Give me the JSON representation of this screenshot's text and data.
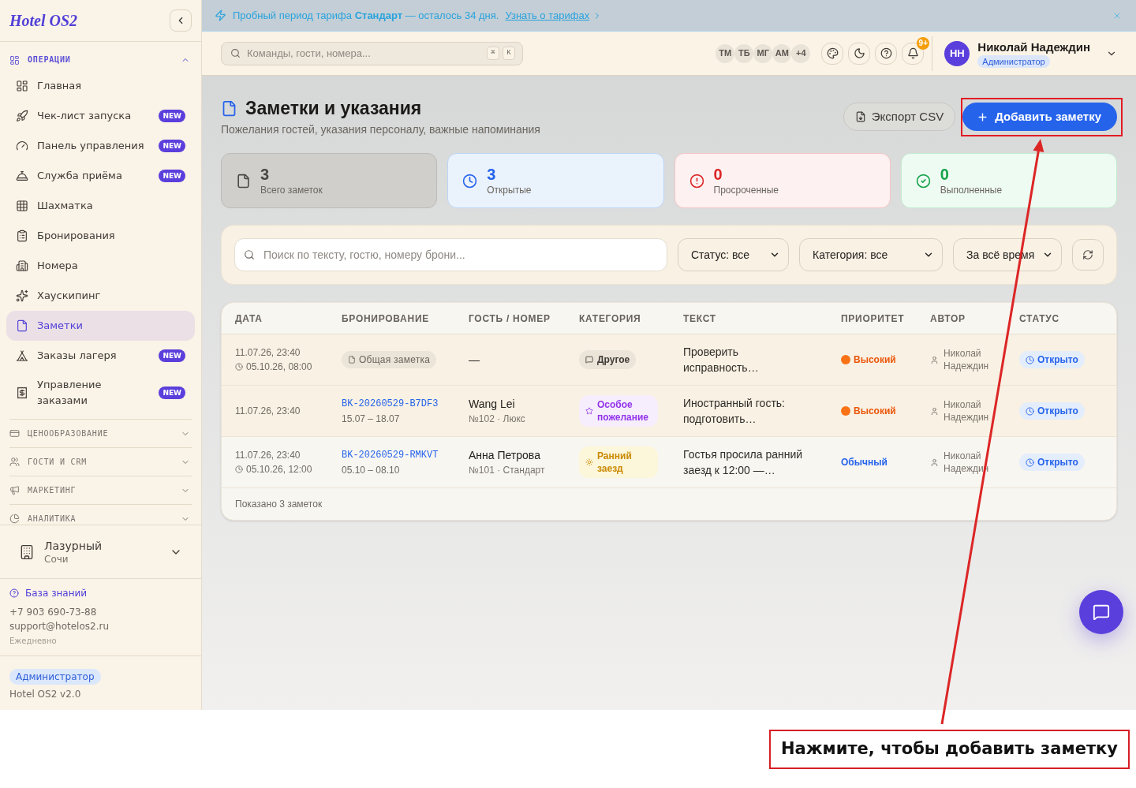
{
  "sidebar": {
    "logo": "Hotel OS2",
    "sections": [
      {
        "title": "ОПЕРАЦИИ",
        "expanded": true,
        "items": [
          {
            "label": "Главная",
            "selected": false
          },
          {
            "label": "Чек-лист запуска",
            "badge": "NEW",
            "selected": false
          },
          {
            "label": "Панель управления",
            "badge": "NEW",
            "selected": false
          },
          {
            "label": "Служба приёма",
            "badge": "NEW",
            "selected": false
          },
          {
            "label": "Шахматка",
            "selected": false
          },
          {
            "label": "Бронирования",
            "selected": false
          },
          {
            "label": "Номера",
            "selected": false
          },
          {
            "label": "Хаускипинг",
            "selected": false
          },
          {
            "label": "Заметки",
            "selected": true
          },
          {
            "label": "Заказы лагеря",
            "badge": "NEW",
            "selected": false
          },
          {
            "label": "Управление заказами",
            "badge": "NEW",
            "selected": false
          }
        ]
      },
      {
        "title": "ЦЕНООБРАЗОВАНИЕ",
        "expanded": false
      },
      {
        "title": "ГОСТИ И CRM",
        "expanded": false
      },
      {
        "title": "МАРКЕТИНГ",
        "expanded": false
      },
      {
        "title": "АНАЛИТИКА",
        "expanded": false
      }
    ],
    "property": {
      "name": "Лазурный",
      "city": "Сочи"
    },
    "support": {
      "link": "База знаний",
      "phone": "+7 903 690-73-88",
      "email": "support@hotelos2.ru",
      "hours": "Ежедневно"
    },
    "footer": {
      "role": "Администратор",
      "version": "Hotel OS2 v2.0"
    }
  },
  "banner": {
    "text": "Пробный период тарифа **Стандарт** — осталось 34 дня.",
    "link": "Узнать о тарифах"
  },
  "topbar": {
    "search": {
      "placeholder": "Команды, гости, номера...",
      "shortcut": [
        "⌘",
        "K"
      ]
    },
    "team": [
      "ТМ",
      "ТБ",
      "МГ",
      "АМ"
    ],
    "team_more": "+4",
    "notifications": "9+",
    "user": {
      "initials": "НН",
      "name": "Николай Надеждин",
      "role": "Администратор"
    }
  },
  "page": {
    "title": "Заметки и указания",
    "subtitle": "Пожелания гостей, указания персоналу, важные напоминания",
    "buttons": [
      {
        "kind": "export",
        "label": "Экспорт CSV"
      },
      {
        "kind": "add",
        "label": "Добавить заметку"
      }
    ]
  },
  "stats": [
    {
      "kind": "total",
      "value": "3",
      "label": "Всего заметок"
    },
    {
      "kind": "open",
      "value": "3",
      "label": "Открытые"
    },
    {
      "kind": "overdue",
      "value": "0",
      "label": "Просроченные"
    },
    {
      "kind": "done",
      "value": "0",
      "label": "Выполненные"
    }
  ],
  "filters": {
    "search": {
      "placeholder": "Поиск по тексту, гостю, номеру брони..."
    },
    "selects": [
      "Статус: все",
      "Категория: все",
      "За всё время"
    ]
  },
  "table": {
    "columns": [
      "ДАТА",
      "БРОНИРОВАНИЕ",
      "ГОСТЬ / НОМЕР",
      "КАТЕГОРИЯ",
      "ТЕКСТ",
      "ПРИОРИТЕТ",
      "АВТОР",
      "СТАТУС"
    ],
    "rows": [
      {
        "date": "11.07.26, 23:40",
        "due": "05.10.26, 08:00",
        "booking": {
          "kind": "general",
          "label": "Общая заметка"
        },
        "guest": {
          "name": "—"
        },
        "category": {
          "kind": "other",
          "label": "Другое"
        },
        "text": "Проверить исправность…",
        "priority": {
          "kind": "high",
          "label": "Высокий"
        },
        "author": "Николай Надеждин",
        "status": {
          "kind": "open",
          "label": "Открыто"
        }
      },
      {
        "date": "11.07.26, 23:40",
        "booking": {
          "kind": "reservation",
          "code": "BK-20260529-B7DF3",
          "dates": "15.07 – 18.07"
        },
        "guest": {
          "name": "Wang Lei",
          "room": "№102 · Люкс"
        },
        "category": {
          "kind": "special",
          "label": "Особое пожелание"
        },
        "text": "Иностранный гость: подготовить…",
        "priority": {
          "kind": "high",
          "label": "Высокий"
        },
        "author": "Николай Надеждин",
        "status": {
          "kind": "open",
          "label": "Открыто"
        }
      },
      {
        "date": "11.07.26, 23:40",
        "due": "05.10.26, 12:00",
        "booking": {
          "kind": "reservation",
          "code": "BK-20260529-RMKVT",
          "dates": "05.10 – 08.10"
        },
        "guest": {
          "name": "Анна Петрова",
          "room": "№101 · Стандарт"
        },
        "category": {
          "kind": "early",
          "label": "Ранний заезд"
        },
        "text": "Гостья просила ранний заезд к 12:00 —…",
        "priority": {
          "kind": "normal",
          "label": "Обычный"
        },
        "author": "Николай Надеждин",
        "status": {
          "kind": "open",
          "label": "Открыто"
        }
      }
    ],
    "footer": "Показано 3 заметок"
  },
  "callout": {
    "text": "Нажмите, чтобы добавить заметку"
  }
}
